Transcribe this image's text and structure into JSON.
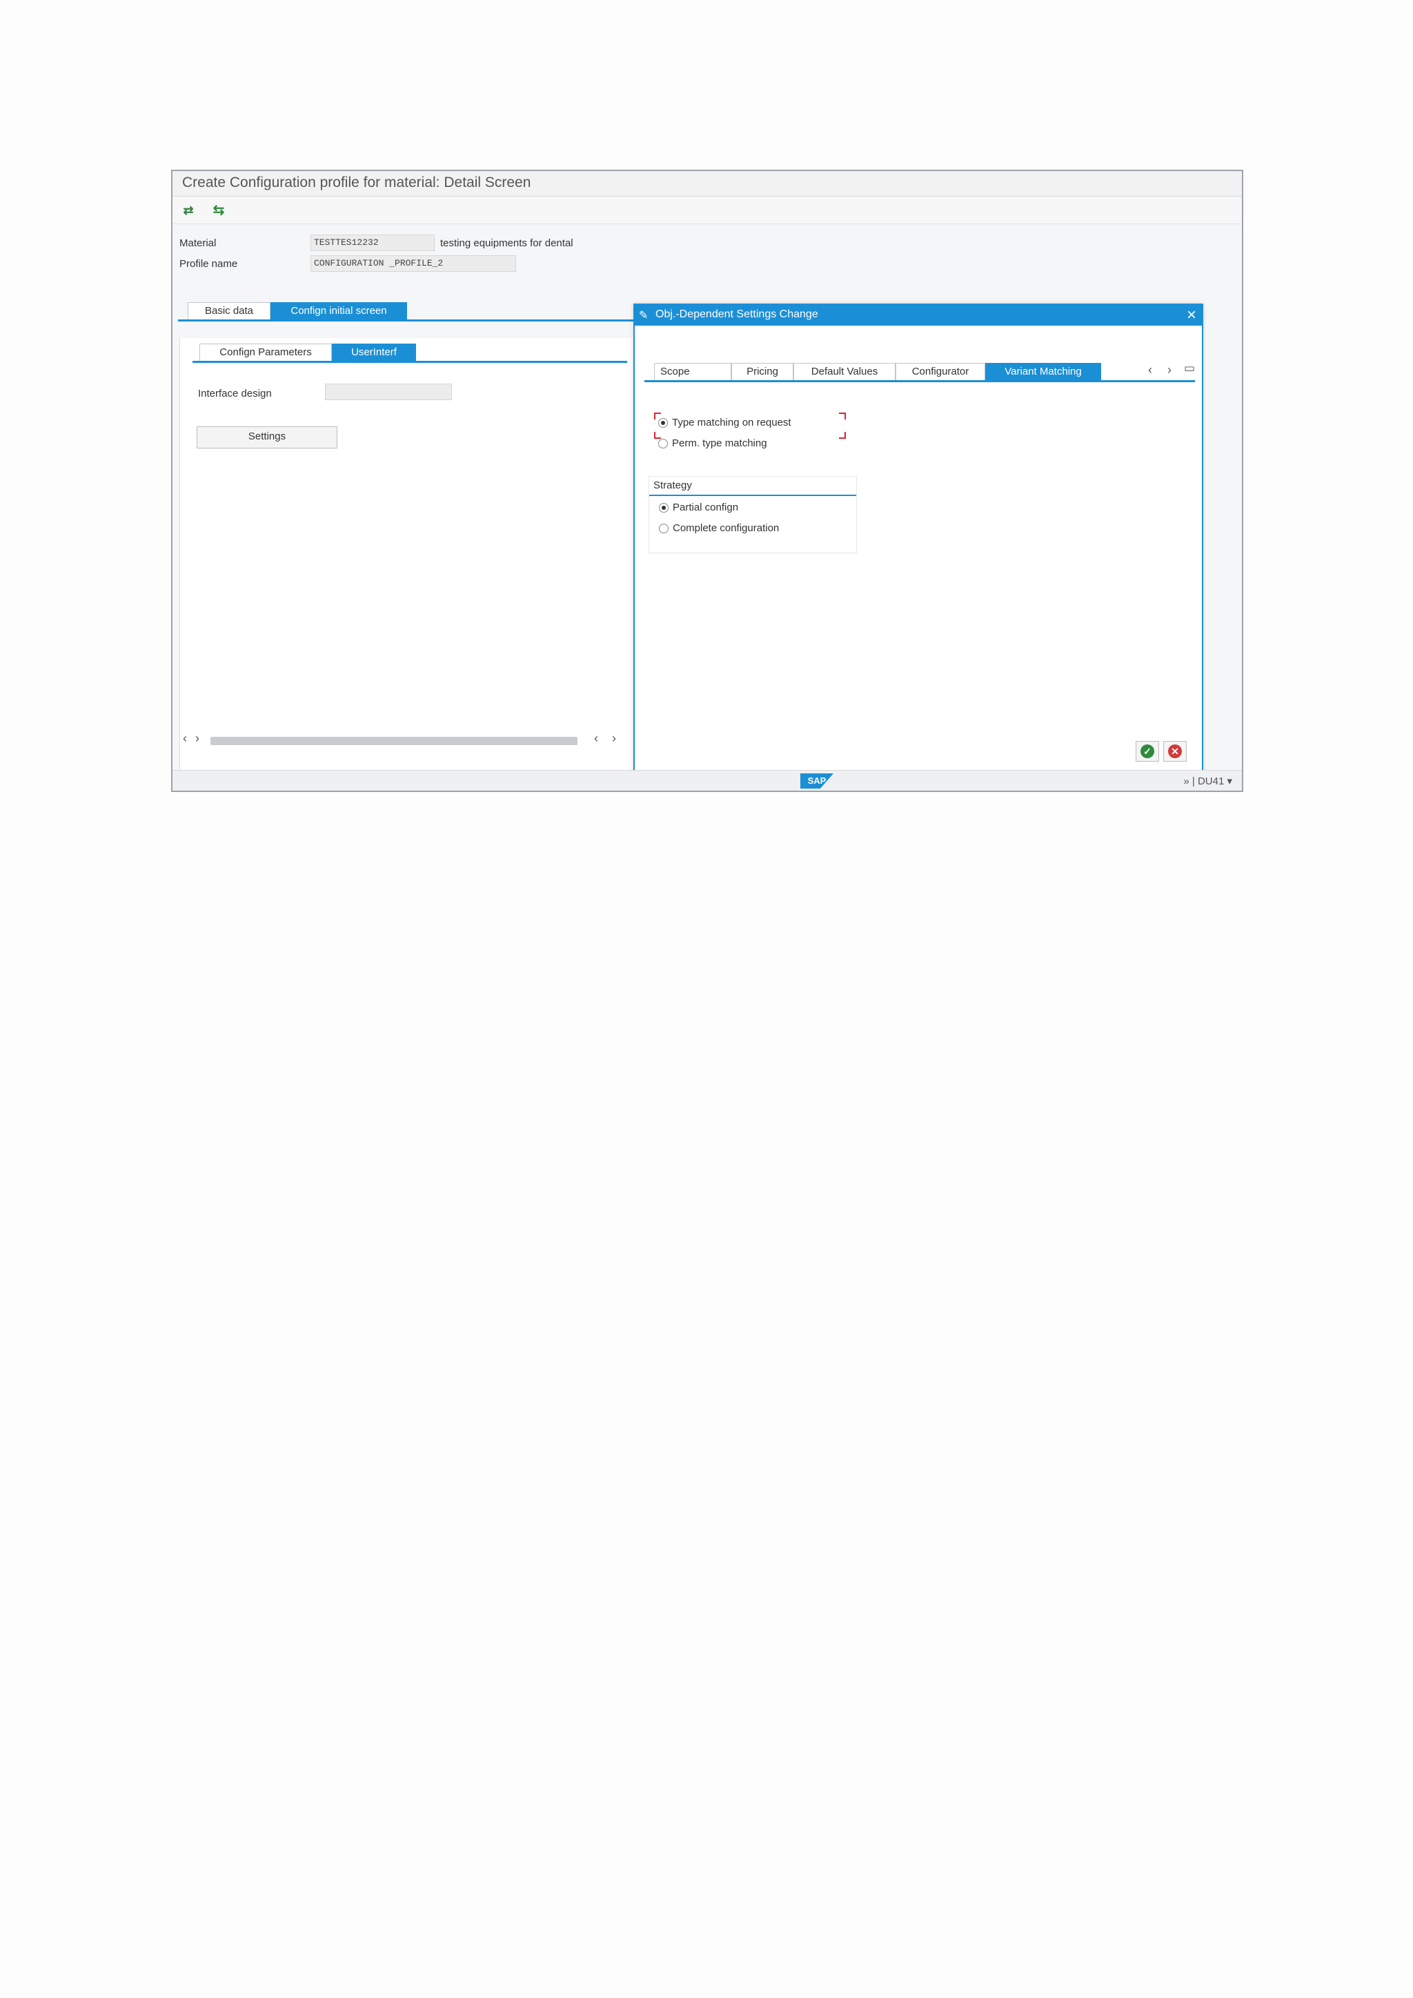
{
  "window": {
    "title": "Create Configuration profile for material: Detail Screen"
  },
  "toolbar": {
    "icons": [
      "other-object-icon",
      "refresh-icon"
    ]
  },
  "header": {
    "material_label": "Material",
    "material_value": "TESTTES12232",
    "material_desc": "testing equipments for dental",
    "profile_label": "Profile name",
    "profile_value": "CONFIGURATION _PROFILE_2"
  },
  "tabs": [
    {
      "label": "Basic data",
      "active": false
    },
    {
      "label": "Confign initial screen",
      "active": true
    }
  ],
  "subtabs": [
    {
      "label": "Confign Parameters",
      "active": false
    },
    {
      "label": "UserInterf",
      "active": true
    }
  ],
  "panel": {
    "interface_label": "Interface design",
    "interface_value": "",
    "settings_button": "Settings"
  },
  "dialog": {
    "title": "Obj.-Dependent Settings Change",
    "tabs": [
      {
        "label": "Scope",
        "active": false
      },
      {
        "label": "Pricing",
        "active": false
      },
      {
        "label": "Default Values",
        "active": false
      },
      {
        "label": "Configurator",
        "active": false
      },
      {
        "label": "Variant Matching",
        "active": true
      }
    ],
    "matching": [
      {
        "label": "Type matching on request",
        "selected": true
      },
      {
        "label": "Perm. type matching",
        "selected": false
      }
    ],
    "strategy_title": "Strategy",
    "strategy": [
      {
        "label": "Partial confign",
        "selected": true
      },
      {
        "label": "Complete configuration",
        "selected": false
      }
    ]
  },
  "statusbar": {
    "logo": "SAP",
    "system": "DU41"
  },
  "colors": {
    "accent": "#1b8fd6",
    "ok": "#2e8b3c",
    "cancel": "#d23a3a"
  }
}
